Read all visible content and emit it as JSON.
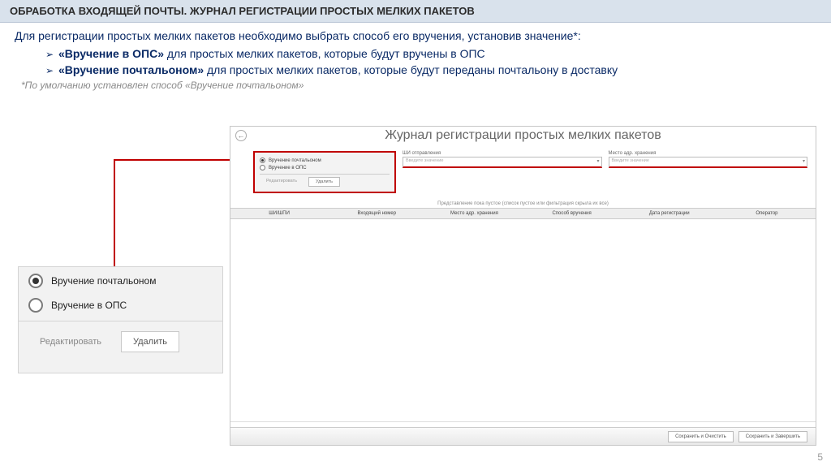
{
  "header": "ОБРАБОТКА ВХОДЯЩЕЙ ПОЧТЫ. ЖУРНАЛ РЕГИСТРАЦИИ ПРОСТЫХ МЕЛКИХ ПАКЕТОВ",
  "intro": "Для регистрации простых мелких пакетов необходимо выбрать способ его вручения, установив значение*:",
  "bullets": [
    {
      "term": "«Вручение в ОПС»",
      "rest": " для простых мелких пакетов, которые будут вручены в ОПС"
    },
    {
      "term": "«Вручение почтальоном»",
      "rest": " для простых мелких пакетов, которые будут переданы почтальону в доставку"
    }
  ],
  "footnote": "*По умолчанию установлен способ «Вручение почтальоном»",
  "page_num": "5",
  "detail_panel": {
    "opt1": "Вручение почтальоном",
    "opt2": "Вручение в ОПС",
    "edit": "Редактировать",
    "delete": "Удалить"
  },
  "app": {
    "title": "Журнал регистрации простых мелких пакетов",
    "back": "←",
    "panel": {
      "opt1": "Вручение почтальоном",
      "opt2": "Вручение в ОПС",
      "edit": "Редактировать",
      "delete": "Удалить"
    },
    "field1_label": "ШИ отправления",
    "field1_ph": "Введите значение",
    "field2_label": "Место адр. хранения",
    "field2_ph": "Введите значение",
    "grid_hint": "Представление пока пустое (список пустое или фильтрация скрыла их все)",
    "cols": {
      "c1": "ШИ/ШПИ",
      "c2": "Входящий номер",
      "c3": "Место адр. хранения",
      "c4": "Способ вручения",
      "c5": "Дата регистрации",
      "c6": "Оператор"
    },
    "footer": {
      "b1": "Сохранить и Очистить",
      "b2": "Сохранить и Завершить"
    }
  }
}
